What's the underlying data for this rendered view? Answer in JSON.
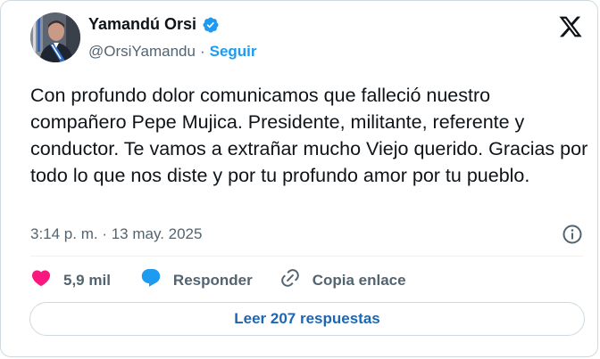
{
  "author": {
    "name": "Yamandú Orsi",
    "handle": "@OrsiYamandu",
    "separator": "·",
    "follow_label": "Seguir"
  },
  "tweet": {
    "text": "Con profundo dolor comunicamos que falleció nuestro compañero Pepe Mujica. Presidente, militante, referente y conductor. Te vamos a extrañar mucho Viejo querido. Gracias por todo lo que nos diste y por tu profundo amor por tu pueblo.",
    "timestamp": "3:14 p. m. · 13 may. 2025"
  },
  "actions": {
    "likes_count": "5,9 mil",
    "reply_label": "Responder",
    "copy_label": "Copia enlace"
  },
  "read_replies_label": "Leer 207 respuestas",
  "colors": {
    "accent": "#1d9bf0",
    "like": "#f91880",
    "text": "#0f1419",
    "muted": "#536471",
    "reply_link": "#1d66b3"
  },
  "icons": [
    "verified-badge-icon",
    "x-logo-icon",
    "info-icon",
    "heart-icon",
    "reply-bubble-icon",
    "link-icon"
  ]
}
